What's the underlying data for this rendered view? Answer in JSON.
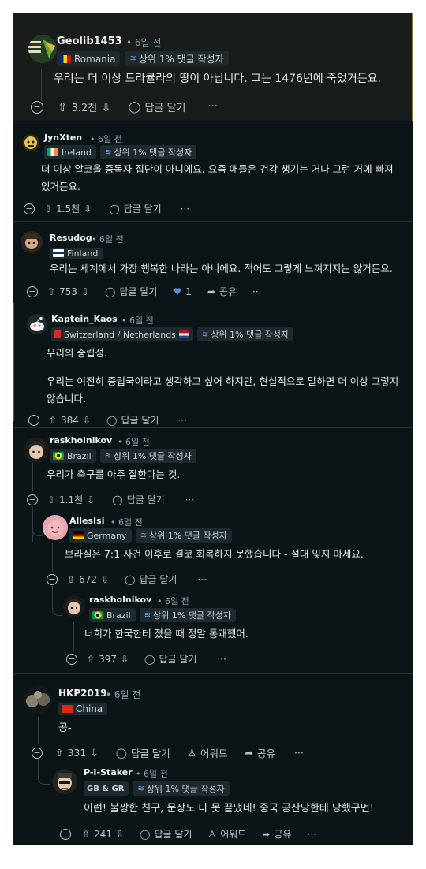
{
  "strings": {
    "ago": "• 6일 전",
    "top1_badge": "상위 1% 댓글 작성자",
    "reply": "답글 달기",
    "award": "어워드",
    "share": "공유",
    "more": "···"
  },
  "comments": [
    {
      "user": "Geolib1453",
      "flair": "Romania",
      "text": "우리는 더 이상 드라큘라의 땅이 아닙니다. 그는 1476년에 죽었거든요.",
      "votes": "3.2천"
    },
    {
      "user": "JynXten",
      "flair": "Ireland",
      "text": "더 이상 알코올 중독자 집단이 아니에요. 요즘 애들은 건강 챙기는 거나 그런 거에 빠져 있거든요.",
      "votes": "1.5천"
    },
    {
      "user": "Resudog",
      "flair": "Finland",
      "text": "우리는 세계에서 가장 행복한 나라는 아니에요. 적어도 그렇게 느껴지지는 않거든요.",
      "votes": "753",
      "reaction_count": "1"
    },
    {
      "user": "Kaptein_Kaos",
      "flair": "Switzerland / Netherlands",
      "text1": "우리의 중립성.",
      "text2": "우리는 여전히 중립국이라고 생각하고 싶어 하지만, 현실적으로 말하면 더 이상 그렇지 않습니다.",
      "votes": "384"
    },
    {
      "user": "raskholnikov",
      "flair": "Brazil",
      "text": "우리가 축구를 아주 잘한다는 것.",
      "votes": "1.1천"
    },
    {
      "user": "AllesIsi",
      "flair": "Germany",
      "text": "브라질은 7:1 사건 이후로 결코 회복하지 못했습니다 - 절대 잊지 마세요.",
      "votes": "672"
    },
    {
      "user": "raskholnikov",
      "flair": "Brazil",
      "text": "너희가 한국한테 졌을 때 정말 통쾌했어.",
      "votes": "397"
    },
    {
      "user": "HKP2019",
      "flair": "China",
      "text": "공-",
      "votes": "331"
    },
    {
      "user": "P-I-Staker",
      "flair": "GB & GR",
      "text": "이런! 불쌍한 친구, 문장도 다 못 끝냈네! 중국 공산당한테 당했구먼!",
      "votes": "241"
    }
  ],
  "colors": {
    "bg": "#0b1416",
    "highlight_bg": "#1a1f1c",
    "highlight_border": "#a08a3a",
    "accent_bar": "#2f52c8",
    "text": "#d7dadc",
    "muted": "#8ba2ad"
  }
}
